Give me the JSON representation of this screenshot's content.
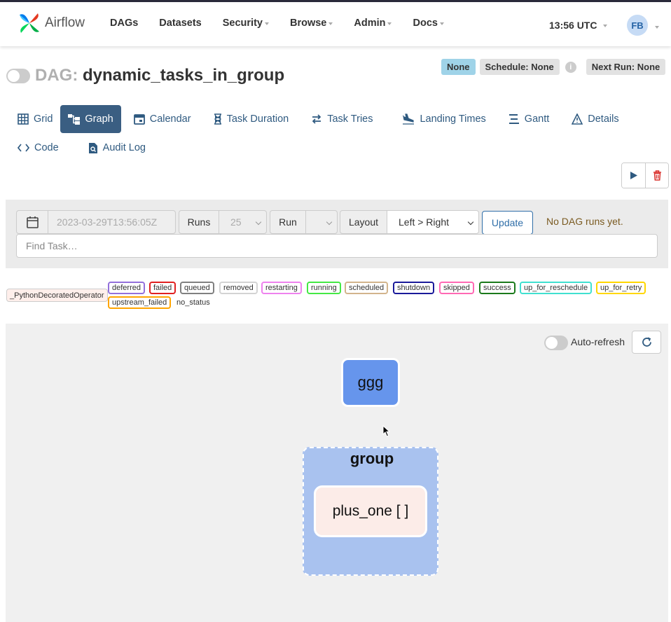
{
  "header": {
    "brand": "Airflow",
    "nav": [
      {
        "label": "DAGs",
        "dropdown": false
      },
      {
        "label": "Datasets",
        "dropdown": false
      },
      {
        "label": "Security",
        "dropdown": true
      },
      {
        "label": "Browse",
        "dropdown": true
      },
      {
        "label": "Admin",
        "dropdown": true
      },
      {
        "label": "Docs",
        "dropdown": true
      }
    ],
    "time": "13:56 UTC",
    "user_initials": "FB"
  },
  "dag": {
    "prefix": "DAG:",
    "name": "dynamic_tasks_in_group",
    "badges": {
      "state": "None",
      "schedule": "Schedule: None",
      "next_run": "Next Run: None"
    },
    "info_icon": "i"
  },
  "tabs": [
    {
      "label": "Grid",
      "icon": "grid-icon",
      "active": false
    },
    {
      "label": "Graph",
      "icon": "graph-icon",
      "active": true
    },
    {
      "label": "Calendar",
      "icon": "calendar-icon",
      "active": false
    },
    {
      "label": "Task Duration",
      "icon": "hourglass-icon",
      "active": false
    },
    {
      "label": "Task Tries",
      "icon": "retry-icon",
      "active": false
    },
    {
      "label": "Landing Times",
      "icon": "plane-landing-icon",
      "active": false
    },
    {
      "label": "Gantt",
      "icon": "gantt-icon",
      "active": false
    },
    {
      "label": "Details",
      "icon": "warning-triangle-icon",
      "active": false
    },
    {
      "label": "Code",
      "icon": "code-icon",
      "active": false
    },
    {
      "label": "Audit Log",
      "icon": "file-search-icon",
      "active": false
    }
  ],
  "filters": {
    "date_placeholder": "2023-03-29T13:56:05Z",
    "runs_label": "Runs",
    "runs_value": "25",
    "run_label": "Run",
    "run_value": "",
    "layout_label": "Layout",
    "layout_value": "Left > Right",
    "update_label": "Update",
    "no_runs_text": "No DAG runs yet.",
    "find_task_placeholder": "Find Task…"
  },
  "legend": {
    "operator": {
      "label": "_PythonDecoratedOperator",
      "color": "#ffefeb"
    },
    "states": [
      {
        "label": "deferred",
        "color": "#9370db"
      },
      {
        "label": "failed",
        "color": "#ff0000"
      },
      {
        "label": "queued",
        "color": "#808080"
      },
      {
        "label": "removed",
        "color": "#d3d3d3"
      },
      {
        "label": "restarting",
        "color": "#ee82ee"
      },
      {
        "label": "running",
        "color": "#00ff00"
      },
      {
        "label": "scheduled",
        "color": "#d2b48c"
      },
      {
        "label": "shutdown",
        "color": "#0000ff"
      },
      {
        "label": "skipped",
        "color": "#ff69b4"
      },
      {
        "label": "success",
        "color": "#008000"
      },
      {
        "label": "up_for_reschedule",
        "color": "#40e0d0"
      },
      {
        "label": "up_for_retry",
        "color": "#ffd700"
      },
      {
        "label": "upstream_failed",
        "color": "#ffa500"
      }
    ],
    "no_status": "no_status"
  },
  "graph": {
    "auto_refresh_label": "Auto-refresh",
    "nodes": {
      "ggg": {
        "label": "ggg",
        "color": "#6695ec"
      },
      "group": {
        "label": "group",
        "color": "#a9c2ef"
      },
      "plus_one": {
        "label": "plus_one [ ]",
        "color": "#fcece8"
      }
    }
  }
}
